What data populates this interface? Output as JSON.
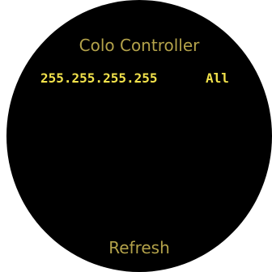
{
  "app": {
    "title": "Colo Controller"
  },
  "device": {
    "ip_address": "255.255.255.255",
    "scope": "All"
  },
  "actions": {
    "refresh_label": "Refresh"
  },
  "colors": {
    "background": "#000000",
    "title_text": "#b3a24a",
    "value_text": "#f2e24b"
  }
}
